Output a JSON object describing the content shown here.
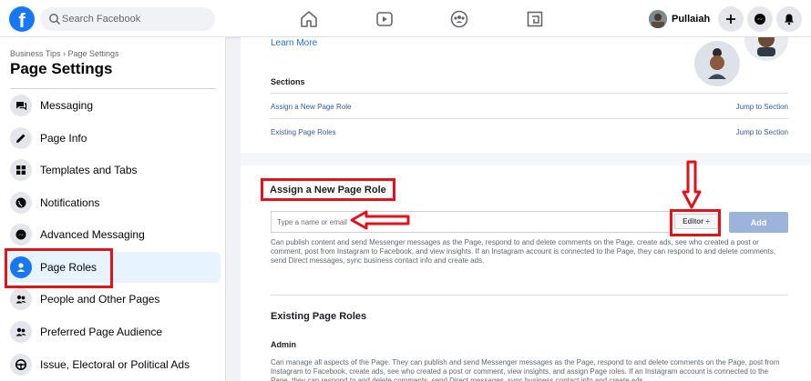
{
  "topbar": {
    "logo": "f",
    "search_placeholder": "Search Facebook",
    "nav_icons": [
      "home-icon",
      "watch-icon",
      "groups-icon",
      "gaming-icon"
    ],
    "profile_name": "Pullaiah",
    "action_icons": [
      "plus-icon",
      "messenger-icon",
      "notifications-icon"
    ]
  },
  "sidebar": {
    "breadcrumb": "Business Tips › Page Settings",
    "title": "Page Settings",
    "items": [
      {
        "label": "Messaging",
        "icon": "speech-bubble-icon"
      },
      {
        "label": "Page Info",
        "icon": "pencil-icon"
      },
      {
        "label": "Templates and Tabs",
        "icon": "grid-icon"
      },
      {
        "label": "Notifications",
        "icon": "globe-icon"
      },
      {
        "label": "Advanced Messaging",
        "icon": "messenger-icon"
      },
      {
        "label": "Page Roles",
        "icon": "person-icon",
        "active": true
      },
      {
        "label": "People and Other Pages",
        "icon": "people-icon"
      },
      {
        "label": "Preferred Page Audience",
        "icon": "people-icon"
      },
      {
        "label": "Issue, Electoral or Political Ads",
        "icon": "steering-wheel-icon"
      }
    ]
  },
  "main": {
    "learn_more": "Learn More",
    "sections_title": "Sections",
    "sections": [
      {
        "label": "Assign a New Page Role",
        "jump": "Jump to Section"
      },
      {
        "label": "Existing Page Roles",
        "jump": "Jump to Section"
      }
    ],
    "assign_title": "Assign a New Page Role",
    "input_placeholder": "Type a name or email",
    "role_select": "Editor ÷",
    "add_button": "Add",
    "editor_description": "Can publish content and send Messenger messages as the Page, respond to and delete comments on the Page, create ads, see who created a post or comment, post from Instagram to Facebook, and view insights. If an Instagram account is connected to the Page, they can respond to and delete comments, send Direct messages, sync business contact info and create ads.",
    "existing_title": "Existing Page Roles",
    "admin_label": "Admin",
    "admin_description": "Can manage all aspects of the Page. They can publish and send Messenger messages as the Page, respond to and delete comments on the Page, post from Instagram to Facebook, create ads, see who created a post or comment, view insights, and assign Page roles. If an Instagram account is connected to the Page, they can respond to and delete comments, send Direct messages, sync business contact info and create ads."
  },
  "colors": {
    "brand": "#1877f2",
    "highlight": "#e0131a",
    "link": "#385898"
  }
}
